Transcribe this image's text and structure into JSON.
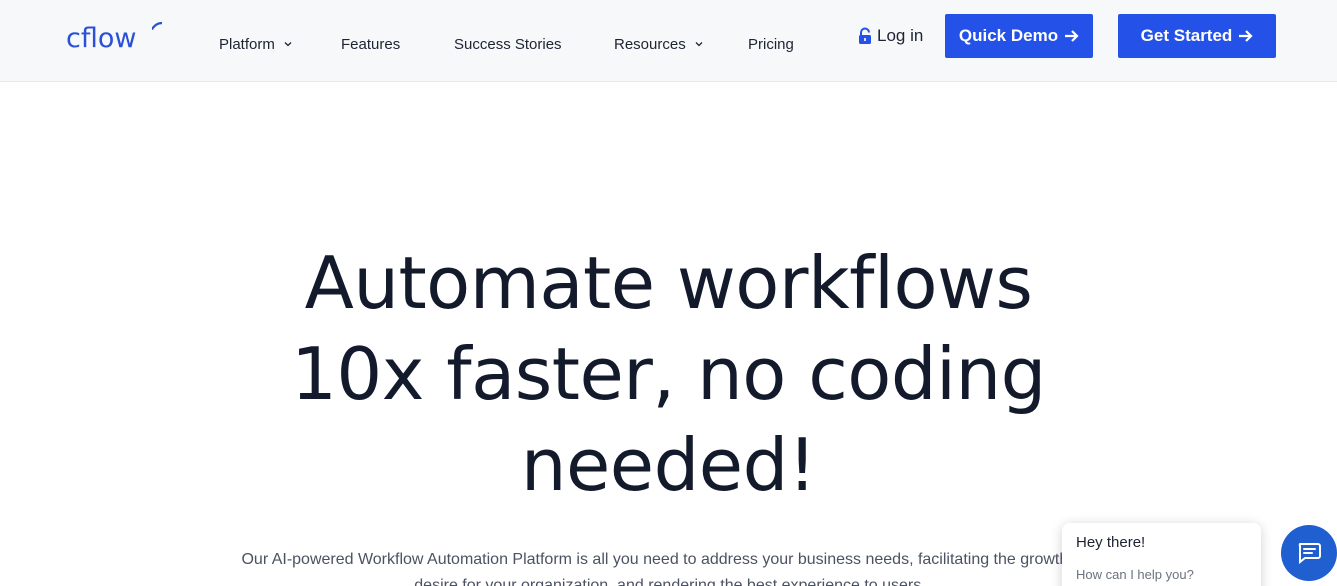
{
  "brand": {
    "name": "cflow",
    "color": "#2950d6"
  },
  "nav": {
    "items": [
      {
        "label": "Platform",
        "has_dropdown": true
      },
      {
        "label": "Features",
        "has_dropdown": false
      },
      {
        "label": "Success Stories",
        "has_dropdown": false
      },
      {
        "label": "Resources",
        "has_dropdown": true
      },
      {
        "label": "Pricing",
        "has_dropdown": false
      }
    ]
  },
  "header": {
    "login_label": "Log in",
    "demo_label": "Quick Demo",
    "start_label": "Get Started",
    "accent_color": "#2452e8",
    "icons": {
      "login": "lock-icon",
      "button_arrow": "arrow-right-icon",
      "dropdown": "chevron-down-icon"
    }
  },
  "hero": {
    "title_lines": [
      "Automate workflows",
      "10x faster, no coding",
      "needed!"
    ],
    "subtitle": "Our AI-powered Workflow Automation Platform is all you need to address your business needs, facilitating the growth you desire for your organization, and rendering the best experience to users."
  },
  "chat": {
    "title": "Hey there!",
    "subtitle": "How can I help you?",
    "launcher_icon": "chat-icon",
    "launcher_color": "#1f5fcf"
  }
}
